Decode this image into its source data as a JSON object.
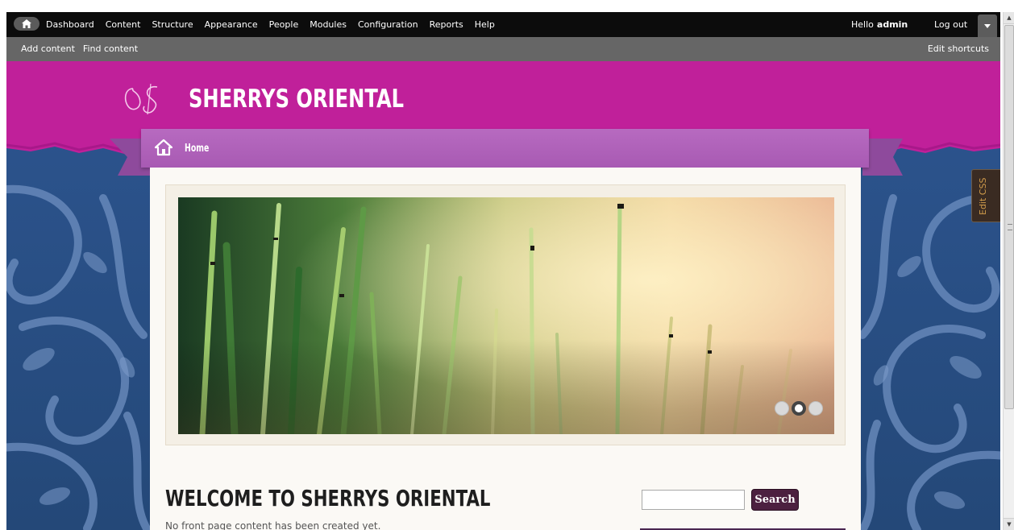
{
  "admin_toolbar": {
    "menu": [
      "Dashboard",
      "Content",
      "Structure",
      "Appearance",
      "People",
      "Modules",
      "Configuration",
      "Reports",
      "Help"
    ],
    "greeting": "Hello",
    "username": "admin",
    "logout": "Log out"
  },
  "shortcuts": {
    "links": [
      "Add content",
      "Find content"
    ],
    "edit": "Edit shortcuts"
  },
  "site": {
    "name": "SHERRYS ORIENTAL",
    "nav_home": "Home"
  },
  "slider": {
    "slide_count": 3,
    "active_index": 1
  },
  "content": {
    "title": "WELCOME TO SHERRYS ORIENTAL",
    "body": "No front page content has been created yet."
  },
  "search": {
    "value": "",
    "button": "Search"
  },
  "edit_css": "Edit CSS",
  "colors": {
    "header_magenta": "#c0209a",
    "ribbon_purple": "#b06abb",
    "damask_blue": "#2a4f86",
    "search_button": "#4c2040"
  },
  "icons": [
    "home-icon",
    "toolbar-home-icon",
    "dropdown-arrow-icon",
    "logo-monogram-icon"
  ]
}
